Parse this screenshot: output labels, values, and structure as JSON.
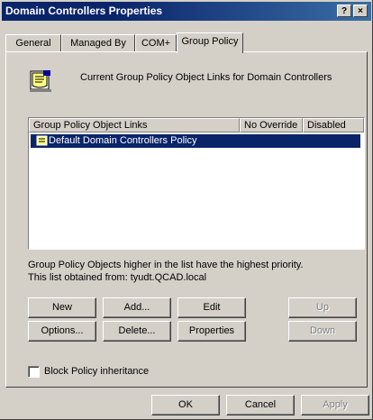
{
  "window": {
    "title": "Domain Controllers Properties",
    "help_label": "?",
    "close_label": "×"
  },
  "tabs": [
    {
      "label": "General"
    },
    {
      "label": "Managed By"
    },
    {
      "label": "COM+"
    },
    {
      "label": "Group Policy",
      "active": true
    }
  ],
  "header": {
    "text": "Current Group Policy Object Links for Domain Controllers",
    "icon": "group-policy-icon"
  },
  "list": {
    "columns": [
      "Group Policy Object Links",
      "No Override",
      "Disabled"
    ],
    "rows": [
      {
        "name": "Default Domain Controllers Policy",
        "icon": "policy-scroll-icon",
        "selected": true
      }
    ]
  },
  "info": {
    "line1": "Group Policy Objects higher in the list have the highest priority.",
    "line2": "This list obtained from: tyudt.QCAD.local"
  },
  "buttons": {
    "new": "New",
    "add": "Add...",
    "edit": "Edit",
    "up": "Up",
    "options": "Options...",
    "delete": "Delete...",
    "properties": "Properties",
    "down": "Down"
  },
  "block_inheritance": {
    "label": "Block Policy inheritance",
    "checked": false
  },
  "footer": {
    "ok": "OK",
    "cancel": "Cancel",
    "apply": "Apply"
  }
}
